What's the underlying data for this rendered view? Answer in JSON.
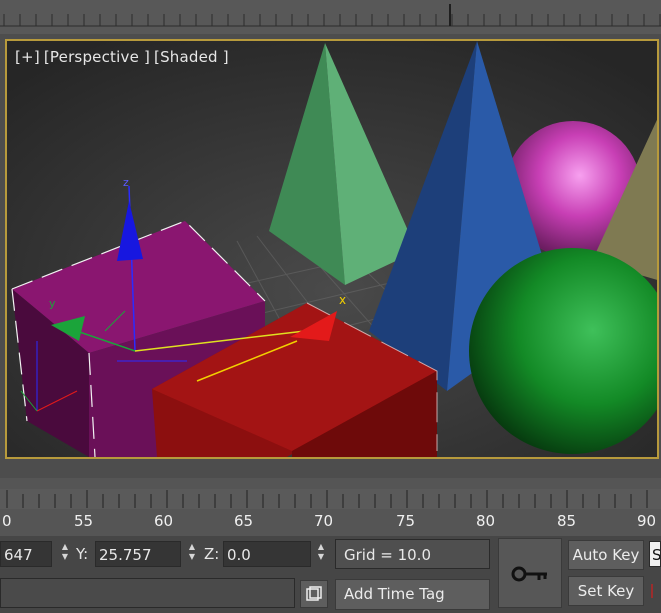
{
  "viewport": {
    "labels": [
      "[+]",
      "[Perspective ]",
      "[Shaded ]"
    ]
  },
  "timeline": {
    "ticks": [
      "0",
      "55",
      "60",
      "65",
      "70",
      "75",
      "80",
      "85",
      "90"
    ]
  },
  "coords": {
    "x_value": "647",
    "y_label": "Y:",
    "y_value": "25.757",
    "z_label": "Z:",
    "z_value": "0.0",
    "grid": "Grid = 10.0"
  },
  "buttons": {
    "add_time_tag": "Add Time Tag",
    "auto_key": "Auto Key",
    "set_key": "Set Key",
    "cut_text": "S"
  },
  "gizmo": {
    "x": "x",
    "y": "y",
    "z": "z"
  },
  "colors": {
    "viewport_border": "#b79a3c",
    "selected_box": "#8a1670",
    "red_box": "#8c0f0f"
  }
}
